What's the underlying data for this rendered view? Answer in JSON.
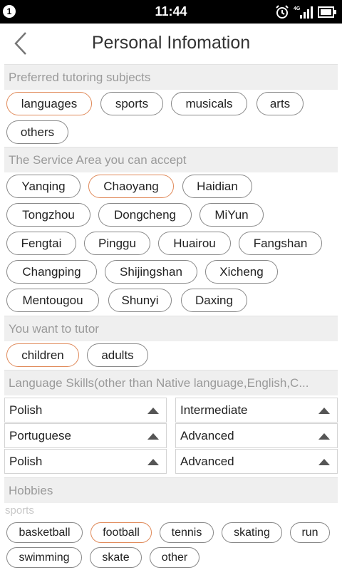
{
  "status": {
    "notif": "1",
    "time": "11:44",
    "network": "4G"
  },
  "header": {
    "title": "Personal Infomation"
  },
  "sections": {
    "subjects": "Preferred tutoring subjects",
    "area": "The Service Area you can accept",
    "tutor": "You want to tutor",
    "language": "Language Skills(other than Native language,English,C...",
    "hobbies": "Hobbies"
  },
  "subjects": [
    "languages",
    "sports",
    "musicals",
    "arts",
    "others"
  ],
  "areas": [
    "Yanqing",
    "Chaoyang",
    "Haidian",
    "Tongzhou",
    "Dongcheng",
    "MiYun",
    "Fengtai",
    "Pinggu",
    "Huairou",
    "Fangshan",
    "Changping",
    "Shijingshan",
    "Xicheng",
    "Mentougou",
    "Shunyi",
    "Daxing"
  ],
  "tutor": [
    "children",
    "adults"
  ],
  "languages": [
    {
      "language": "Polish",
      "level": "Intermediate"
    },
    {
      "language": "Portuguese",
      "level": "Advanced"
    },
    {
      "language": "Polish",
      "level": "Advanced"
    }
  ],
  "hobbies": {
    "category": "sports",
    "items": [
      "basketball",
      "football",
      "tennis",
      "skating",
      "run",
      "swimming",
      "skate",
      "other"
    ]
  },
  "selected": {
    "subjects": [
      "languages"
    ],
    "areas": [
      "Chaoyang"
    ],
    "tutor": [
      "children"
    ],
    "hobbies": [
      "football"
    ]
  },
  "colors": {
    "accent": "#e08a5a",
    "section_bg": "#efefef"
  }
}
